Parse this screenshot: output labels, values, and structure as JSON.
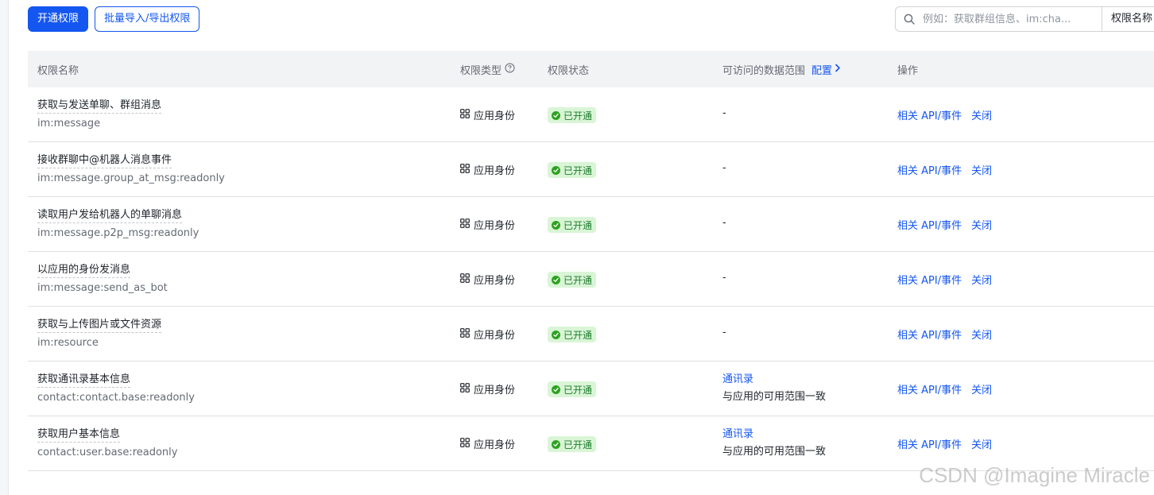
{
  "toolbar": {
    "grant_label": "开通权限",
    "import_export_label": "批量导入/导出权限"
  },
  "search": {
    "placeholder": "例如：获取群组信息、im:cha...",
    "icon": "search-icon",
    "filter_field": "权限名称"
  },
  "table": {
    "headers": {
      "name": "权限名称",
      "type": "权限类型",
      "type_help_icon": "help-circle-icon",
      "status": "权限状态",
      "range": "可访问的数据范围",
      "range_config": "配置",
      "ops": "操作"
    },
    "rows": [
      {
        "title": "获取与发送单聊、群组消息",
        "code": "im:message",
        "type": "应用身份",
        "status": "已开通",
        "range_link": "",
        "range_note": "-",
        "op_api": "相关 API/事件",
        "op_close": "关闭"
      },
      {
        "title": "接收群聊中@机器人消息事件",
        "code": "im:message.group_at_msg:readonly",
        "type": "应用身份",
        "status": "已开通",
        "range_link": "",
        "range_note": "-",
        "op_api": "相关 API/事件",
        "op_close": "关闭"
      },
      {
        "title": "读取用户发给机器人的单聊消息",
        "code": "im:message.p2p_msg:readonly",
        "type": "应用身份",
        "status": "已开通",
        "range_link": "",
        "range_note": "-",
        "op_api": "相关 API/事件",
        "op_close": "关闭"
      },
      {
        "title": "以应用的身份发消息",
        "code": "im:message:send_as_bot",
        "type": "应用身份",
        "status": "已开通",
        "range_link": "",
        "range_note": "-",
        "op_api": "相关 API/事件",
        "op_close": "关闭"
      },
      {
        "title": "获取与上传图片或文件资源",
        "code": "im:resource",
        "type": "应用身份",
        "status": "已开通",
        "range_link": "",
        "range_note": "-",
        "op_api": "相关 API/事件",
        "op_close": "关闭"
      },
      {
        "title": "获取通讯录基本信息",
        "code": "contact:contact.base:readonly",
        "type": "应用身份",
        "status": "已开通",
        "range_link": "通讯录",
        "range_note": "与应用的可用范围一致",
        "op_api": "相关 API/事件",
        "op_close": "关闭"
      },
      {
        "title": "获取用户基本信息",
        "code": "contact:user.base:readonly",
        "type": "应用身份",
        "status": "已开通",
        "range_link": "通讯录",
        "range_note": "与应用的可用范围一致",
        "op_api": "相关 API/事件",
        "op_close": "关闭"
      }
    ]
  },
  "icons": {
    "type": "app-grid-icon",
    "status": "check-circle-icon",
    "config": "chevron-right-icon"
  },
  "colors": {
    "primary": "#1456f0",
    "success_bg": "#d9f5d6",
    "success_text": "#1e7c2e",
    "header_bg": "#f2f3f5"
  },
  "watermark": "CSDN @Imagine Miracle"
}
